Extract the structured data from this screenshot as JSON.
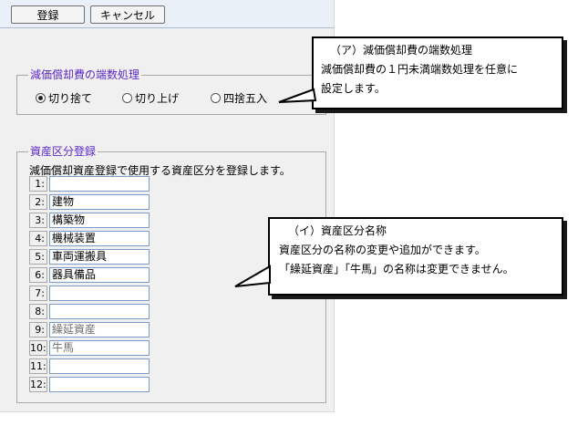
{
  "toolbar": {
    "register_label": "登録",
    "cancel_label": "キャンセル"
  },
  "rounding": {
    "legend": "減価償却費の端数処理",
    "options": [
      "切り捨て",
      "切り上げ",
      "四捨五入"
    ],
    "selected": "切り捨て"
  },
  "assets": {
    "legend": "資産区分登録",
    "description": "減価償却資産登録で使用する資産区分を登録します。",
    "rows": [
      {
        "num": "1:",
        "value": ""
      },
      {
        "num": "2:",
        "value": "建物"
      },
      {
        "num": "3:",
        "value": "構築物"
      },
      {
        "num": "4:",
        "value": "機械装置"
      },
      {
        "num": "5:",
        "value": "車両運搬具"
      },
      {
        "num": "6:",
        "value": "器具備品"
      },
      {
        "num": "7:",
        "value": ""
      },
      {
        "num": "8:",
        "value": ""
      },
      {
        "num": "9:",
        "value": "繰延資産"
      },
      {
        "num": "10:",
        "value": "牛馬"
      },
      {
        "num": "11:",
        "value": ""
      },
      {
        "num": "12:",
        "value": ""
      }
    ]
  },
  "callout_a": {
    "title": "（ア）減価償却費の端数処理",
    "line1": "減価償却費の１円未満端数処理を任意に",
    "line2": "設定します。"
  },
  "callout_b": {
    "title": "（イ）資産区分名称",
    "line1": "資産区分の名称の変更や追加ができます。",
    "line2": "「繰延資産」「牛馬」の名称は変更できません。"
  },
  "colors": {
    "legend": "#5a27c8",
    "toolbar_bg": "#eaf0f8",
    "panel_bg": "#f0f0f0"
  }
}
